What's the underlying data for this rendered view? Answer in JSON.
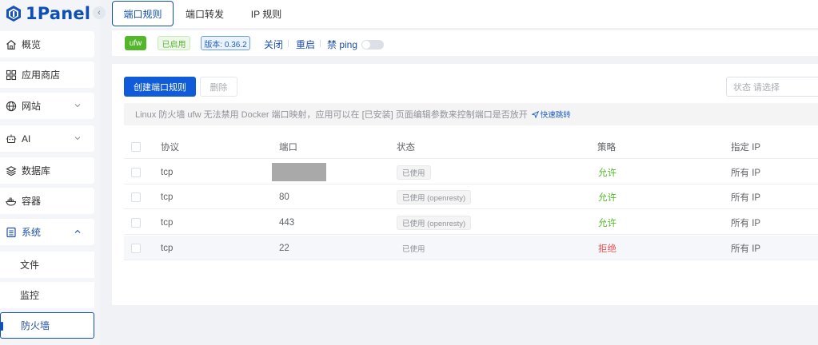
{
  "app": {
    "logo_text": "1Panel",
    "collapse_glyph": "‹"
  },
  "sidebar": {
    "items": [
      {
        "label": "概览",
        "icon": "home-icon"
      },
      {
        "label": "应用商店",
        "icon": "grid-icon"
      },
      {
        "label": "网站",
        "icon": "globe-icon",
        "expandable": true
      },
      {
        "label": "AI",
        "icon": "robot-icon",
        "expandable": true
      },
      {
        "label": "数据库",
        "icon": "layers-icon"
      },
      {
        "label": "容器",
        "icon": "docker-icon"
      },
      {
        "label": "系统",
        "icon": "system-icon",
        "expanded": true
      }
    ],
    "sub_items": [
      {
        "label": "文件"
      },
      {
        "label": "监控"
      },
      {
        "label": "防火墙",
        "active": true
      }
    ]
  },
  "tabs": [
    {
      "label": "端口规则",
      "active": true
    },
    {
      "label": "端口转发"
    },
    {
      "label": "IP 规则"
    }
  ],
  "status": {
    "engine": "ufw",
    "state": "已启用",
    "version": "版本: 0.36.2",
    "stop": "关闭",
    "restart": "重启",
    "ping_label": "禁 ping",
    "ping_enabled": false
  },
  "toolbar": {
    "create": "创建端口规则",
    "delete": "删除",
    "filter_placeholder": "状态  请选择"
  },
  "notice": {
    "text": "Linux 防火墙 ufw 无法禁用 Docker 端口映射，应用可以在 [已安装] 页面编辑参数来控制端口是否放开",
    "jump": "快速跳转"
  },
  "table": {
    "headers": [
      "协议",
      "端口",
      "状态",
      "策略",
      "指定 IP"
    ],
    "rows": [
      {
        "protocol": "tcp",
        "port": "",
        "port_redacted": true,
        "status": "已使用",
        "policy": "允许",
        "policy_kind": "allow",
        "ip": "所有 IP"
      },
      {
        "protocol": "tcp",
        "port": "80",
        "status": "已使用 (openresty)",
        "policy": "允许",
        "policy_kind": "allow",
        "ip": "所有 IP"
      },
      {
        "protocol": "tcp",
        "port": "443",
        "status": "已使用 (openresty)",
        "policy": "允许",
        "policy_kind": "allow",
        "ip": "所有 IP"
      },
      {
        "protocol": "tcp",
        "port": "22",
        "status": "已使用",
        "policy": "拒绝",
        "policy_kind": "deny",
        "ip": "所有 IP",
        "hovered": true
      }
    ]
  },
  "colors": {
    "brand": "#0f4fb3",
    "allow": "#52b82a",
    "deny": "#e85454"
  }
}
